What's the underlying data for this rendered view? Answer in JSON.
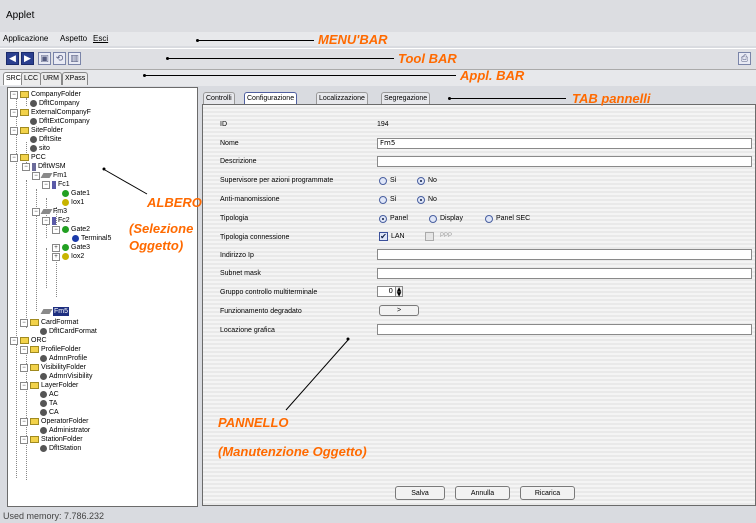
{
  "window": {
    "title": "Applet"
  },
  "menu": {
    "items": [
      "Applicazione",
      "Aspetto",
      "Esci"
    ]
  },
  "toolbar": {
    "buttons": [
      "back-icon",
      "forward-icon",
      "save-icon",
      "refresh-icon",
      "delete-icon",
      "print-icon"
    ]
  },
  "appl_bar": {
    "tabs": [
      "SRC",
      "LCC",
      "URM",
      "XPass"
    ],
    "selected": "SRC"
  },
  "tree": {
    "nodes": [
      "CompanyFolder",
      "DfltCompany",
      "ExternalCompanyF",
      "DfltExtCompany",
      "SiteFolder",
      "DfltSite",
      "sito",
      "PCC",
      "DfltWSM",
      "Fm1",
      "Fc1",
      "Gate1",
      "Iox1",
      "Fm3",
      "Fc2",
      "Gate2",
      "Terminal5",
      "Gate3",
      "Iox2",
      "Fm5",
      "CardFormat",
      "DfltCardFormat",
      "ORC",
      "ProfileFolder",
      "AdmnProfile",
      "VisibilityFolder",
      "AdmnVisibility",
      "LayerFolder",
      "AC",
      "TA",
      "CA",
      "OperatorFolder",
      "Administrator",
      "StationFolder",
      "DfltStation"
    ],
    "selected": "Fm5"
  },
  "panel_tabs": {
    "tabs": [
      "Controlli",
      "Configurazione",
      "Localizzazione",
      "Segregazione"
    ],
    "selected": "Configurazione"
  },
  "form": {
    "id_label": "ID",
    "id_value": "194",
    "nome_label": "Nome",
    "nome_value": "Fm5",
    "descrizione_label": "Descrizione",
    "descrizione_value": "",
    "supervisore_label": "Supervisore per azioni programmate",
    "antimanomissione_label": "Anti-manomissione",
    "si": "Sì",
    "no": "No",
    "tipologia_label": "Tipologia",
    "tipologia_options": [
      "Panel",
      "Display",
      "Panel SEC"
    ],
    "connessione_label": "Tipologia connessione",
    "lan": "LAN",
    "ppp": "PPP",
    "indirizzo_label": "Indirizzo Ip",
    "indirizzo_value": "",
    "subnet_label": "Subnet mask",
    "subnet_value": "",
    "gruppo_label": "Gruppo controllo multiterminale",
    "gruppo_value": "0",
    "funzionamento_label": "Funzionamento degradato",
    "funzionamento_button": ">",
    "locazione_label": "Locazione grafica",
    "locazione_value": ""
  },
  "buttons": {
    "salva": "Salva",
    "annulla": "Annulla",
    "ricarica": "Ricarica"
  },
  "status": {
    "memory": "Used memory: 7.786.232"
  },
  "annotations": {
    "menubar": "MENU'BAR",
    "toolbar": "Tool BAR",
    "applbar": "Appl. BAR",
    "tabpannelli": "TAB pannelli",
    "albero": "ALBERO",
    "selezione1": "(Selezione",
    "selezione2": "Oggetto)",
    "pannello": "PANNELLO",
    "manutenzione": "(Manutenzione Oggetto)"
  },
  "colors": {
    "annotation": "#ff6a00",
    "selection": "#1e2f80",
    "folder": "#f2d24a"
  }
}
